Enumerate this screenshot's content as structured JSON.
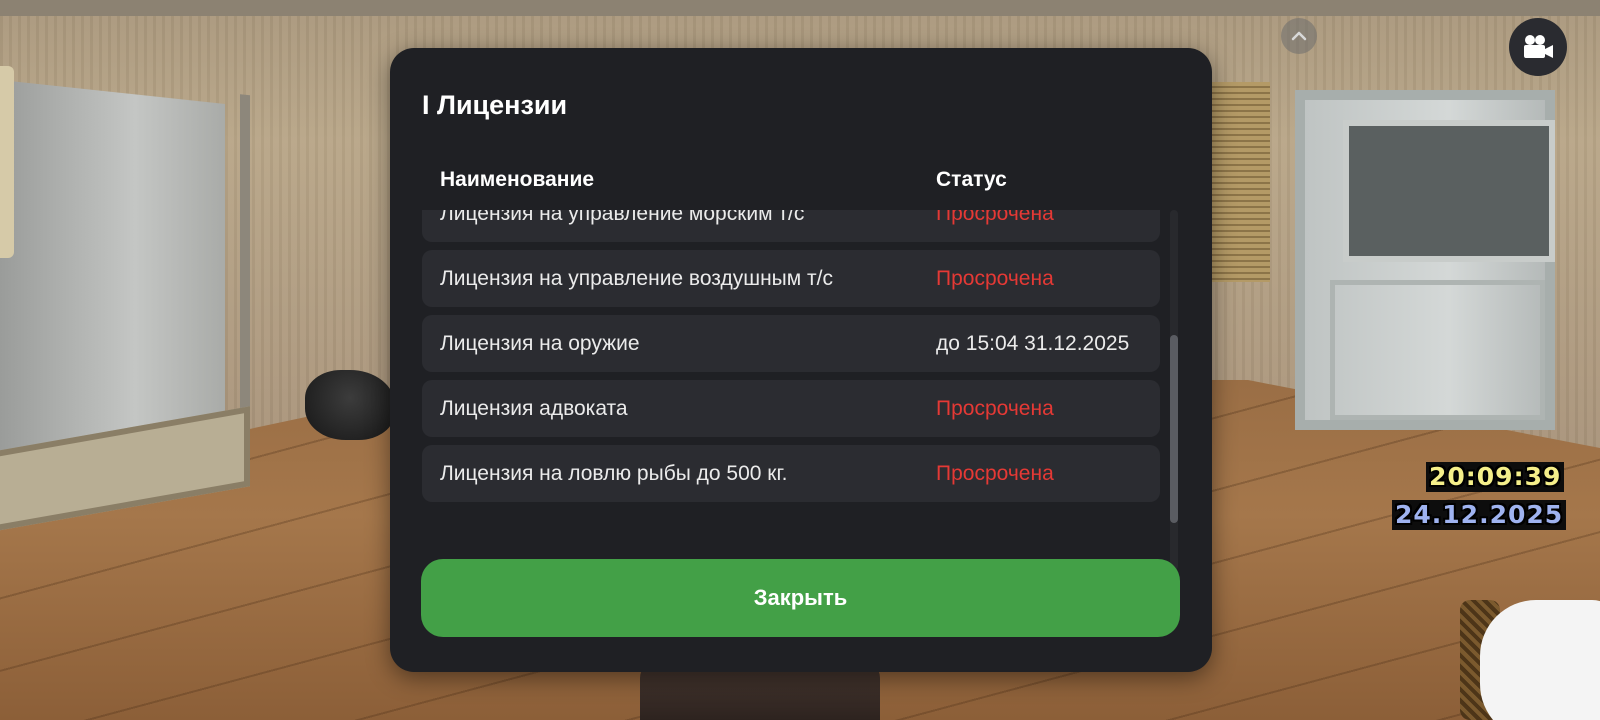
{
  "modal": {
    "title": "I Лицензии",
    "columns": {
      "name": "Наименование",
      "status": "Статус"
    },
    "rows": [
      {
        "name": "Лицензия на управление морским т/с",
        "status": "Просрочена",
        "status_color": "#e53935"
      },
      {
        "name": "Лицензия на управление воздушным т/с",
        "status": "Просрочена",
        "status_color": "#e53935"
      },
      {
        "name": "Лицензия на оружие",
        "status": "до 15:04 31.12.2025",
        "status_color": "#ebebeb"
      },
      {
        "name": "Лицензия адвоката",
        "status": "Просрочена",
        "status_color": "#e53935"
      },
      {
        "name": "Лицензия на ловлю рыбы до 500 кг.",
        "status": "Просрочена",
        "status_color": "#e53935"
      }
    ],
    "close_label": "Закрыть",
    "close_color": "#43a047"
  },
  "hud": {
    "time": "20:09:39",
    "date": "24.12.2025",
    "camera_icon": "video-camera-icon",
    "collapse_icon": "chevron-up-icon"
  }
}
